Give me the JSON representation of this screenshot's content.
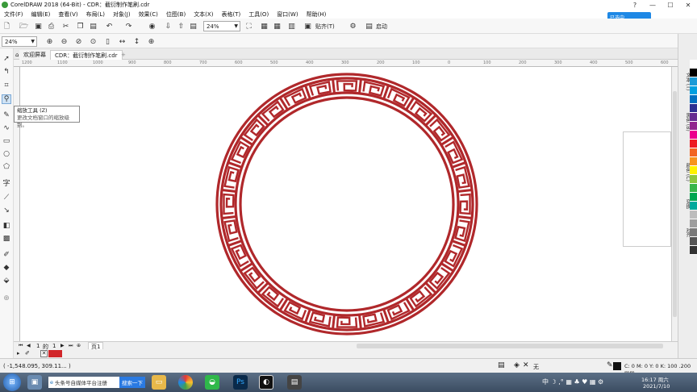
{
  "window": {
    "title": "CorelDRAW 2018 (64-Bit) - CDR：截衍制作笔刷.cdr"
  },
  "menu": [
    "文件(F)",
    "编辑(E)",
    "查看(V)",
    "布局(L)",
    "对象(J)",
    "效果(C)",
    "位图(B)",
    "文本(X)",
    "表格(T)",
    "工具(O)",
    "窗口(W)",
    "帮助(H)"
  ],
  "toolbar1": {
    "zoom_value": "24%",
    "snap_label": "贴齐(T)",
    "launch_label": "启动"
  },
  "toolbar2": {
    "zoom_value": "24%"
  },
  "tabs": {
    "welcome": "欢迎屏幕",
    "document": "CDR：截衍制作笔刷.cdr",
    "add": "+"
  },
  "ruler_h": [
    "1200",
    "1100",
    "1000",
    "900",
    "800",
    "700",
    "600",
    "500",
    "400",
    "300",
    "200",
    "100",
    "0",
    "100",
    "200",
    "300",
    "400",
    "500",
    "600"
  ],
  "tooltip": {
    "title": "缩放工具 (Z)",
    "desc": "更改文档窗口的缩放级别。"
  },
  "page_nav": {
    "current": "1",
    "of": "的",
    "total": "1",
    "page_tab": "页1"
  },
  "status": {
    "coords": "( -1,548.095, 309.11... )",
    "fill_none": "无",
    "color_readout": "C: 0 M: 0 Y: 0 K: 100  .200 mm"
  },
  "taskbar": {
    "search_placeholder": "头条号自媒体平台注册",
    "search_button": "搜索一下",
    "clock_time": "16:17 周六",
    "clock_date": "2021/7/10"
  },
  "ime": {
    "label": "已选中",
    "extras": "中 ☽ ,° ▦ ♣ ♥ ▦ ⚙"
  },
  "dockers": [
    "文本 (T)",
    "黑色 (B)",
    "颜色 (C)",
    "变换",
    "对齐"
  ],
  "colors": {
    "accent_red": "#b0282b",
    "palette": [
      "#ffffff",
      "#000000",
      "#1a9bd7",
      "#00a0e0",
      "#0070c0",
      "#2e3192",
      "#662d91",
      "#92278f",
      "#ec008c",
      "#ed1c24",
      "#f26522",
      "#f7941d",
      "#fff200",
      "#8dc63f",
      "#39b54a",
      "#00a651",
      "#00a99d",
      "#bdbdbd",
      "#9e9e9e",
      "#7a7a7a",
      "#555555",
      "#333333"
    ]
  }
}
